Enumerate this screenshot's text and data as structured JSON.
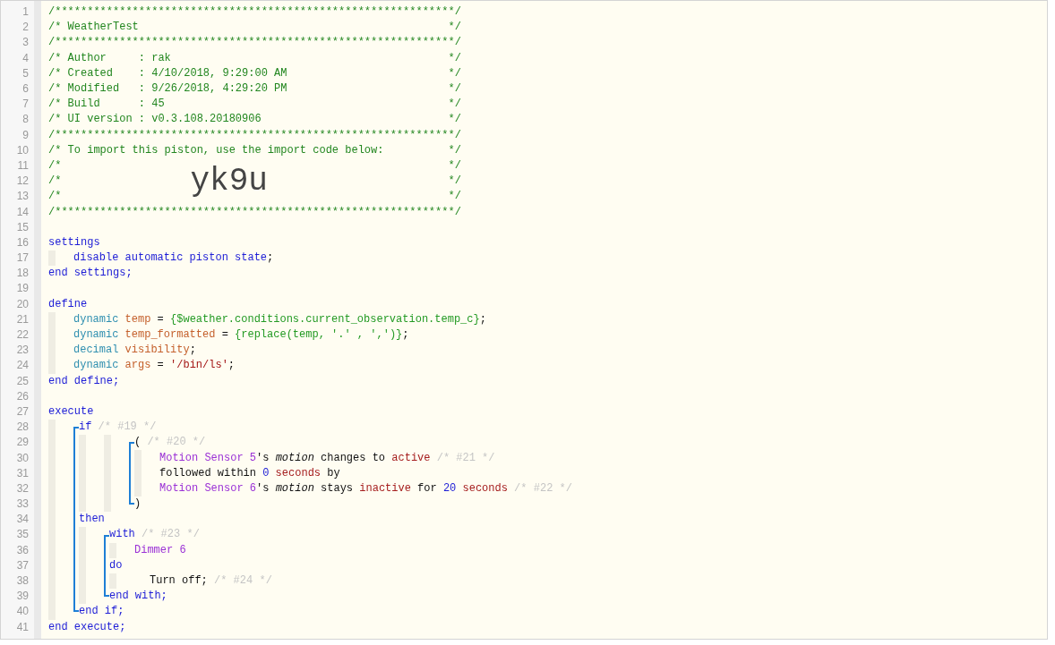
{
  "lines": [
    {
      "number": "1",
      "segments": [
        {
          "kind": "comment",
          "text": "/**************************************************************/"
        }
      ]
    },
    {
      "number": "2",
      "segments": [
        {
          "kind": "comment",
          "text": "/* WeatherTest                                                */"
        }
      ]
    },
    {
      "number": "3",
      "segments": [
        {
          "kind": "comment",
          "text": "/**************************************************************/"
        }
      ]
    },
    {
      "number": "4",
      "segments": [
        {
          "kind": "comment",
          "text": "/* Author     : rak                                           */"
        }
      ]
    },
    {
      "number": "5",
      "segments": [
        {
          "kind": "comment",
          "text": "/* Created    : 4/10/2018, 9:29:00 AM                         */"
        }
      ]
    },
    {
      "number": "6",
      "segments": [
        {
          "kind": "comment",
          "text": "/* Modified   : 9/26/2018, 4:29:20 PM                         */"
        }
      ]
    },
    {
      "number": "7",
      "segments": [
        {
          "kind": "comment",
          "text": "/* Build      : 45                                            */"
        }
      ]
    },
    {
      "number": "8",
      "segments": [
        {
          "kind": "comment",
          "text": "/* UI version : v0.3.108.20180906                             */"
        }
      ]
    },
    {
      "number": "9",
      "segments": [
        {
          "kind": "comment",
          "text": "/**************************************************************/"
        }
      ]
    },
    {
      "number": "10",
      "segments": [
        {
          "kind": "comment",
          "text": "/* To import this piston, use the import code below:          */"
        }
      ]
    },
    {
      "number": "11",
      "segments": [
        {
          "kind": "comment",
          "text": "/*                                                            */"
        }
      ]
    },
    {
      "number": "12",
      "segments": [
        {
          "kind": "comment",
          "text": "/*                    "
        },
        {
          "kind": "code",
          "text": "yk9u"
        },
        {
          "kind": "comment",
          "text": "                            */"
        }
      ]
    },
    {
      "number": "13",
      "segments": [
        {
          "kind": "comment",
          "text": "/*                                                            */"
        }
      ]
    },
    {
      "number": "14",
      "segments": [
        {
          "kind": "comment",
          "text": "/**************************************************************/"
        }
      ]
    },
    {
      "number": "15"
    },
    {
      "number": "16",
      "segments": [
        {
          "kind": "keyword",
          "text": "settings"
        }
      ]
    },
    {
      "number": "17",
      "rails": [
        {
          "kind": "guide"
        }
      ],
      "segments": [
        {
          "kind": "keyword",
          "text": "disable automatic piston state"
        },
        {
          "kind": "plain",
          "text": ";"
        }
      ]
    },
    {
      "number": "18",
      "segments": [
        {
          "kind": "keyword",
          "text": "end settings;"
        }
      ]
    },
    {
      "number": "19"
    },
    {
      "number": "20",
      "segments": [
        {
          "kind": "keyword",
          "text": "define"
        }
      ]
    },
    {
      "number": "21",
      "rails": [
        {
          "kind": "guide"
        }
      ],
      "segments": [
        {
          "kind": "type",
          "text": "dynamic "
        },
        {
          "kind": "variable",
          "text": "temp"
        },
        {
          "kind": "plain",
          "text": " = "
        },
        {
          "kind": "expression",
          "text": "{$weather.conditions.current_observation.temp_c}"
        },
        {
          "kind": "plain",
          "text": ";"
        }
      ]
    },
    {
      "number": "22",
      "rails": [
        {
          "kind": "guide"
        }
      ],
      "segments": [
        {
          "kind": "type",
          "text": "dynamic "
        },
        {
          "kind": "variable",
          "text": "temp_formatted"
        },
        {
          "kind": "plain",
          "text": " = "
        },
        {
          "kind": "expression",
          "text": "{replace(temp, '.' , ',')}"
        },
        {
          "kind": "plain",
          "text": ";"
        }
      ]
    },
    {
      "number": "23",
      "rails": [
        {
          "kind": "guide"
        }
      ],
      "segments": [
        {
          "kind": "type",
          "text": "decimal "
        },
        {
          "kind": "variable",
          "text": "visibility"
        },
        {
          "kind": "plain",
          "text": ";"
        }
      ]
    },
    {
      "number": "24",
      "rails": [
        {
          "kind": "guide"
        }
      ],
      "segments": [
        {
          "kind": "type",
          "text": "dynamic "
        },
        {
          "kind": "variable",
          "text": "args"
        },
        {
          "kind": "plain",
          "text": " = "
        },
        {
          "kind": "string",
          "text": "'/bin/ls'"
        },
        {
          "kind": "plain",
          "text": ";"
        }
      ]
    },
    {
      "number": "25",
      "segments": [
        {
          "kind": "keyword",
          "text": "end define;"
        }
      ]
    },
    {
      "number": "26"
    },
    {
      "number": "27",
      "segments": [
        {
          "kind": "keyword",
          "text": "execute"
        }
      ]
    },
    {
      "number": "28",
      "rails": [
        {
          "kind": "guide"
        },
        {
          "kind": "top"
        }
      ],
      "segments": [
        {
          "kind": "keyword",
          "text": "if "
        },
        {
          "kind": "muted",
          "text": "/* #19 */"
        }
      ]
    },
    {
      "number": "29",
      "rails": [
        {
          "kind": "guide"
        },
        {
          "kind": "mid"
        },
        {
          "kind": "guide"
        },
        {
          "kind": "guide"
        },
        {
          "kind": "top"
        }
      ],
      "segments": [
        {
          "kind": "plain",
          "text": "( "
        },
        {
          "kind": "muted",
          "text": "/* #20 */"
        }
      ]
    },
    {
      "number": "30",
      "rails": [
        {
          "kind": "guide"
        },
        {
          "kind": "mid"
        },
        {
          "kind": "guide"
        },
        {
          "kind": "guide"
        },
        {
          "kind": "mid"
        },
        {
          "kind": "guide"
        }
      ],
      "segments": [
        {
          "kind": "device",
          "text": "Motion Sensor 5"
        },
        {
          "kind": "plain",
          "text": "'s "
        },
        {
          "kind": "attribute",
          "text": "motion"
        },
        {
          "kind": "plain",
          "text": " changes to "
        },
        {
          "kind": "value",
          "text": "active"
        },
        {
          "kind": "muted",
          "text": " /* #21 */"
        }
      ]
    },
    {
      "number": "31",
      "rails": [
        {
          "kind": "guide"
        },
        {
          "kind": "mid"
        },
        {
          "kind": "guide"
        },
        {
          "kind": "guide"
        },
        {
          "kind": "mid"
        },
        {
          "kind": "guide"
        }
      ],
      "segments": [
        {
          "kind": "plain",
          "text": "followed within "
        },
        {
          "kind": "number",
          "text": "0"
        },
        {
          "kind": "value",
          "text": " seconds"
        },
        {
          "kind": "plain",
          "text": " by"
        }
      ]
    },
    {
      "number": "32",
      "rails": [
        {
          "kind": "guide"
        },
        {
          "kind": "mid"
        },
        {
          "kind": "guide"
        },
        {
          "kind": "guide"
        },
        {
          "kind": "mid"
        },
        {
          "kind": "guide"
        }
      ],
      "segments": [
        {
          "kind": "device",
          "text": "Motion Sensor 6"
        },
        {
          "kind": "plain",
          "text": "'s "
        },
        {
          "kind": "attribute",
          "text": "motion"
        },
        {
          "kind": "plain",
          "text": " stays "
        },
        {
          "kind": "value",
          "text": "inactive"
        },
        {
          "kind": "plain",
          "text": " for "
        },
        {
          "kind": "number",
          "text": "20"
        },
        {
          "kind": "value",
          "text": " seconds"
        },
        {
          "kind": "muted",
          "text": " /* #22 */"
        }
      ]
    },
    {
      "number": "33",
      "rails": [
        {
          "kind": "guide"
        },
        {
          "kind": "mid"
        },
        {
          "kind": "guide"
        },
        {
          "kind": "guide"
        },
        {
          "kind": "bottom"
        }
      ],
      "segments": [
        {
          "kind": "plain",
          "text": ")"
        }
      ]
    },
    {
      "number": "34",
      "rails": [
        {
          "kind": "guide"
        },
        {
          "kind": "mid"
        }
      ],
      "segments": [
        {
          "kind": "keyword",
          "text": "then"
        }
      ]
    },
    {
      "number": "35",
      "rails": [
        {
          "kind": "guide"
        },
        {
          "kind": "mid"
        },
        {
          "kind": "guide"
        },
        {
          "kind": "top"
        }
      ],
      "segments": [
        {
          "kind": "keyword",
          "text": "with "
        },
        {
          "kind": "muted",
          "text": "/* #23 */"
        }
      ]
    },
    {
      "number": "36",
      "rails": [
        {
          "kind": "guide"
        },
        {
          "kind": "mid"
        },
        {
          "kind": "guide"
        },
        {
          "kind": "mid"
        },
        {
          "kind": "guide"
        }
      ],
      "segments": [
        {
          "kind": "device",
          "text": "Dimmer 6"
        }
      ]
    },
    {
      "number": "37",
      "rails": [
        {
          "kind": "guide"
        },
        {
          "kind": "mid"
        },
        {
          "kind": "guide"
        },
        {
          "kind": "mid"
        }
      ],
      "segments": [
        {
          "kind": "keyword",
          "text": "do"
        }
      ]
    },
    {
      "number": "38",
      "rails": [
        {
          "kind": "guide"
        },
        {
          "kind": "mid"
        },
        {
          "kind": "guide"
        },
        {
          "kind": "mid"
        },
        {
          "kind": "guide"
        },
        {
          "kind": "pad"
        }
      ],
      "segments": [
        {
          "kind": "plain",
          "text": "Turn off; "
        },
        {
          "kind": "muted",
          "text": "/* #24 */"
        }
      ]
    },
    {
      "number": "39",
      "rails": [
        {
          "kind": "guide"
        },
        {
          "kind": "mid"
        },
        {
          "kind": "guide"
        },
        {
          "kind": "bottom"
        }
      ],
      "segments": [
        {
          "kind": "keyword",
          "text": "end with;"
        }
      ]
    },
    {
      "number": "40",
      "rails": [
        {
          "kind": "guide"
        },
        {
          "kind": "bottom"
        }
      ],
      "segments": [
        {
          "kind": "keyword",
          "text": "end if;"
        }
      ]
    },
    {
      "number": "41",
      "segments": [
        {
          "kind": "keyword",
          "text": "end execute;"
        }
      ]
    }
  ]
}
